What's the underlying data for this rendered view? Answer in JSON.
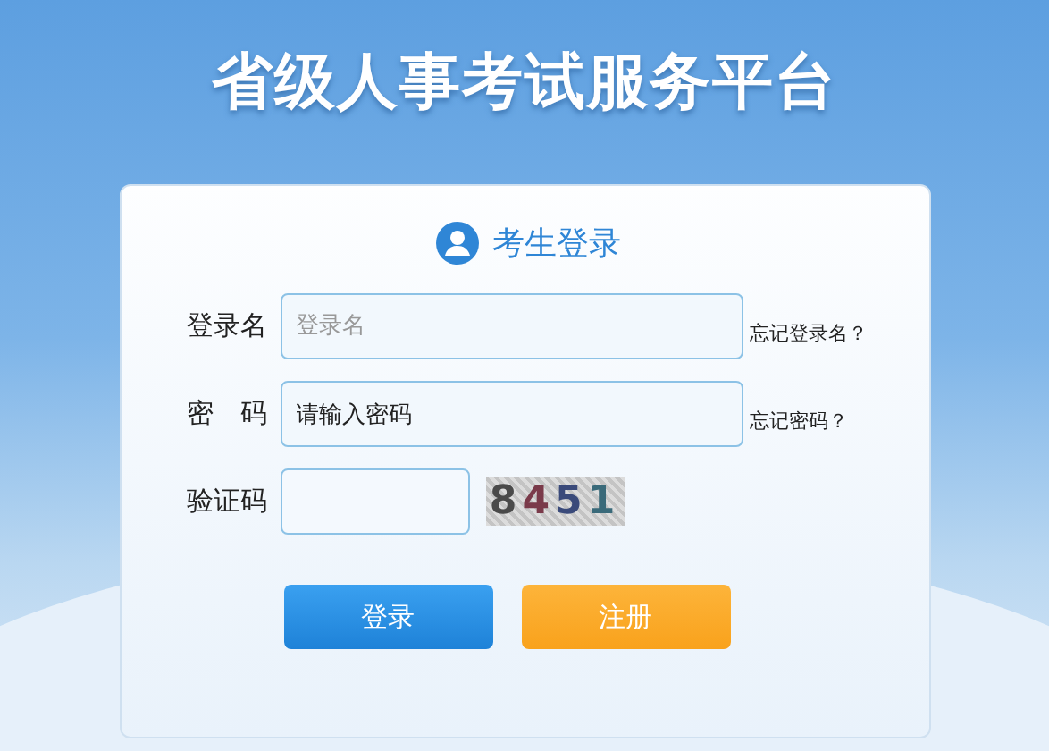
{
  "title": "省级人事考试服务平台",
  "login_panel": {
    "heading": "考生登录",
    "fields": [
      {
        "kind": "text",
        "label": "登录名",
        "placeholder": "登录名",
        "link": "忘记登录名？"
      },
      {
        "kind": "password",
        "label": "密　码",
        "value": "请输入密码",
        "link": "忘记密码？"
      },
      {
        "kind": "captcha",
        "label": "验证码",
        "captcha": "8451"
      }
    ],
    "buttons": [
      {
        "kind": "primary",
        "label": "登录"
      },
      {
        "kind": "secondary",
        "label": "注册"
      }
    ]
  }
}
